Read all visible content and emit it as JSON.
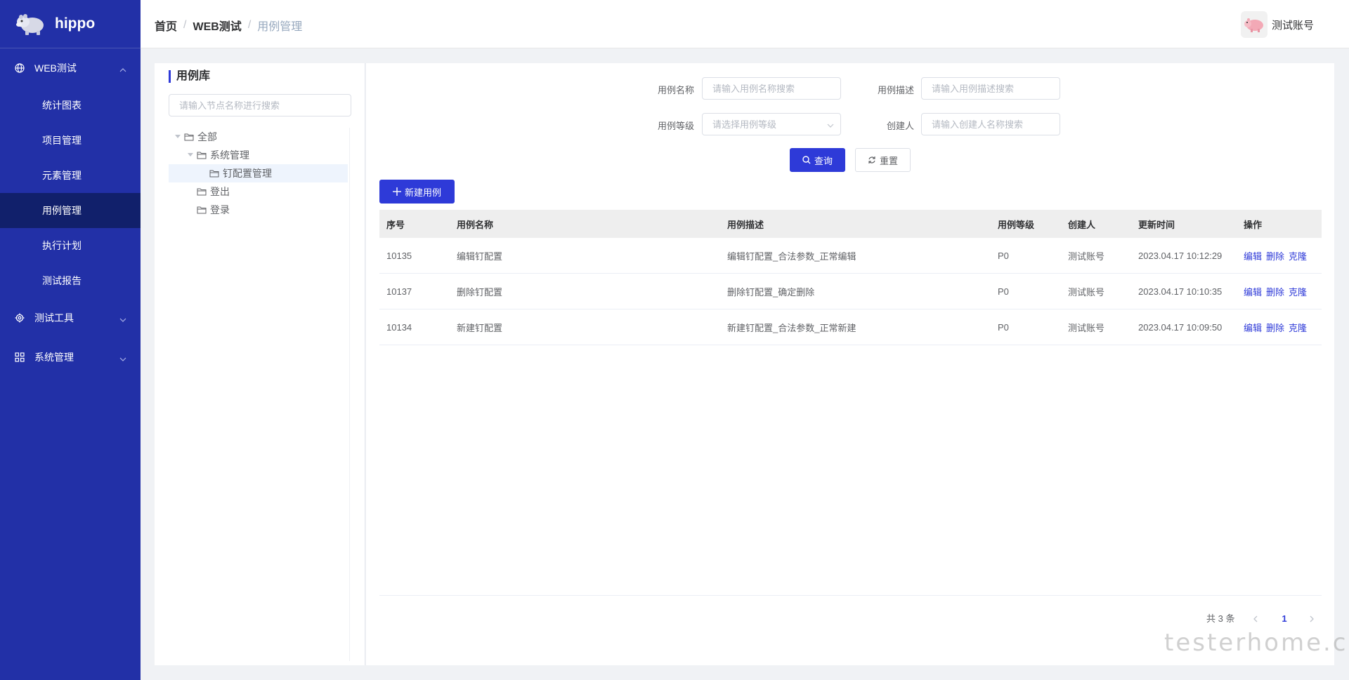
{
  "app": {
    "name": "hippo"
  },
  "sidebar": {
    "groups": [
      {
        "label": "WEB测试",
        "icon": "globe-icon",
        "expanded": true
      },
      {
        "label": "测试工具",
        "icon": "gear-icon",
        "expanded": false
      },
      {
        "label": "系统管理",
        "icon": "grid-icon",
        "expanded": false
      }
    ],
    "items": [
      {
        "label": "统计图表"
      },
      {
        "label": "项目管理"
      },
      {
        "label": "元素管理"
      },
      {
        "label": "用例管理",
        "active": true
      },
      {
        "label": "执行计划"
      },
      {
        "label": "测试报告"
      }
    ]
  },
  "header": {
    "breadcrumb": [
      "首页",
      "WEB测试",
      "用例管理"
    ],
    "separator": "/",
    "user_name": "测试账号"
  },
  "tree": {
    "title": "用例库",
    "search_placeholder": "请输入节点名称进行搜索",
    "nodes": [
      {
        "label": "全部",
        "level": 0,
        "expanded": true
      },
      {
        "label": "系统管理",
        "level": 1,
        "expanded": true
      },
      {
        "label": "钉配置管理",
        "level": 2,
        "selected": true
      },
      {
        "label": "登出",
        "level": 1
      },
      {
        "label": "登录",
        "level": 1
      }
    ]
  },
  "search_form": {
    "name_label": "用例名称",
    "name_placeholder": "请输入用例名称搜索",
    "desc_label": "用例描述",
    "desc_placeholder": "请输入用例描述搜索",
    "level_label": "用例等级",
    "level_placeholder": "请选择用例等级",
    "creator_label": "创建人",
    "creator_placeholder": "请输入创建人名称搜索",
    "query_label": "查询",
    "reset_label": "重置"
  },
  "toolbar": {
    "new_case_label": "新建用例"
  },
  "table": {
    "columns": [
      "序号",
      "用例名称",
      "用例描述",
      "用例等级",
      "创建人",
      "更新时间",
      "操作"
    ],
    "rows": [
      {
        "id": "10135",
        "name": "编辑钉配置",
        "desc": "编辑钉配置_合法参数_正常编辑",
        "level": "P0",
        "creator": "测试账号",
        "updated": "2023.04.17 10:12:29"
      },
      {
        "id": "10137",
        "name": "删除钉配置",
        "desc": "删除钉配置_确定删除",
        "level": "P0",
        "creator": "测试账号",
        "updated": "2023.04.17 10:10:35"
      },
      {
        "id": "10134",
        "name": "新建钉配置",
        "desc": "新建钉配置_合法参数_正常新建",
        "level": "P0",
        "creator": "测试账号",
        "updated": "2023.04.17 10:09:50"
      }
    ],
    "actions": [
      "编辑",
      "删除",
      "克隆"
    ]
  },
  "pagination": {
    "total_text": "共 3 条",
    "current_page": "1"
  },
  "watermark": "testerhome.com",
  "colors": {
    "sidebar_bg": "#2230a7",
    "sidebar_active": "#11206b",
    "primary": "#2e3ad8"
  }
}
